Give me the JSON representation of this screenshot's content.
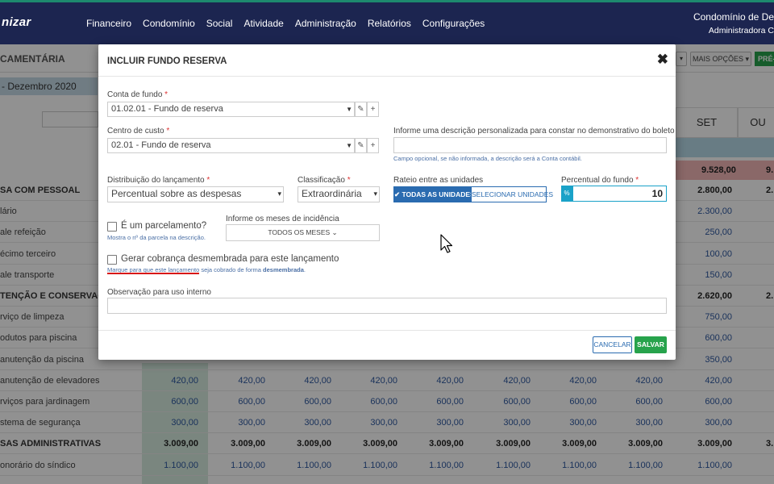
{
  "header": {
    "logo": "nizar",
    "nav": [
      "Financeiro",
      "Condomínio",
      "Social",
      "Atividade",
      "Administração",
      "Relatórios",
      "Configurações"
    ],
    "condo_name": "Condomínio de De",
    "condo_admin": "Administradora C"
  },
  "page": {
    "title": "CAMENTÁRIA",
    "period": "- Dezembro 2020",
    "mais_opcoes": "MAIS OPÇÕES",
    "pre_button": "PRÉ-",
    "columns": [
      "SET",
      "OU"
    ],
    "summary_set": "9.528,00",
    "summary_next": "9."
  },
  "background_rows": [
    {
      "label": "SA COM PESSOAL",
      "bold": true,
      "values": [],
      "set": "2.800,00",
      "next": "2."
    },
    {
      "label": "lário",
      "bold": false,
      "values": [],
      "set": "2.300,00",
      "next": ""
    },
    {
      "label": "ale refeição",
      "bold": false,
      "values": [],
      "set": "250,00",
      "next": ""
    },
    {
      "label": "écimo terceiro",
      "bold": false,
      "values": [],
      "set": "100,00",
      "next": ""
    },
    {
      "label": "ale transporte",
      "bold": false,
      "values": [],
      "set": "150,00",
      "next": ""
    },
    {
      "label": "TENÇÃO E CONSERVAÇÃO",
      "bold": true,
      "values": [],
      "set": "2.620,00",
      "next": "2."
    },
    {
      "label": "rviço de limpeza",
      "bold": false,
      "values": [],
      "set": "750,00",
      "next": ""
    },
    {
      "label": "odutos para piscina",
      "bold": false,
      "values": [],
      "set": "600,00",
      "next": ""
    },
    {
      "label": "anutenção da piscina",
      "bold": false,
      "values": [],
      "set": "350,00",
      "next": ""
    },
    {
      "label": "anutenção de elevadores",
      "bold": false,
      "values": [
        "420,00",
        "420,00",
        "420,00",
        "420,00",
        "420,00",
        "420,00",
        "420,00",
        "420,00"
      ],
      "set": "420,00",
      "next": ""
    },
    {
      "label": "rviços para jardinagem",
      "bold": false,
      "values": [
        "600,00",
        "600,00",
        "600,00",
        "600,00",
        "600,00",
        "600,00",
        "600,00",
        "600,00"
      ],
      "set": "600,00",
      "next": ""
    },
    {
      "label": "stema de segurança",
      "bold": false,
      "values": [
        "300,00",
        "300,00",
        "300,00",
        "300,00",
        "300,00",
        "300,00",
        "300,00",
        "300,00"
      ],
      "set": "300,00",
      "next": ""
    },
    {
      "label": "SAS ADMINISTRATIVAS",
      "bold": true,
      "values": [
        "3.009,00",
        "3.009,00",
        "3.009,00",
        "3.009,00",
        "3.009,00",
        "3.009,00",
        "3.009,00",
        "3.009,00"
      ],
      "set": "3.009,00",
      "next": "3."
    },
    {
      "label": "onorário do síndico",
      "bold": false,
      "values": [
        "1.100,00",
        "1.100,00",
        "1.100,00",
        "1.100,00",
        "1.100,00",
        "1.100,00",
        "1.100,00",
        "1.100,00"
      ],
      "set": "1.100,00",
      "next": ""
    }
  ],
  "modal": {
    "title": "INCLUIR FUNDO RESERVA",
    "close": "✖",
    "conta_label": "Conta de fundo",
    "conta_value": "01.02.01 - Fundo de reserva",
    "centro_label": "Centro de custo",
    "centro_value": "02.01 - Fundo de reserva",
    "descricao_label": "Informe uma descrição personalizada para constar no demonstrativo do boleto",
    "descricao_hint": "Campo opcional, se não informada, a descrição será a Conta contábil.",
    "distribuicao_label": "Distribuição do lançamento",
    "distribuicao_value": "Percentual sobre as despesas",
    "classificacao_label": "Classificação",
    "classificacao_value": "Extraordinária",
    "rateio_label": "Rateio entre as unidades",
    "rateio_todas": "✔ TODAS AS UNIDADES",
    "rateio_selecionar": "SELECIONAR UNIDADES",
    "percentual_label": "Percentual do fundo",
    "percentual_addon": "%",
    "percentual_value": "10",
    "parcelamento_label": "É um parcelamento?",
    "parcelamento_hint": "Mostra o nº da parcela na descrição.",
    "meses_label": "Informe os meses de incidência",
    "meses_value": "TODOS OS MESES ⌄",
    "desmembrada_label": "Gerar cobrança desmembrada para este lançamento",
    "desmembrada_hint_a": "Marque para que este lançamento seja cobrado de forma ",
    "desmembrada_hint_b": "desmembrada",
    "desmembrada_hint_c": ".",
    "observacao_label": "Observação para uso interno",
    "cancel": "CANCELAR",
    "save": "SALVAR"
  },
  "colors": {
    "navbar": "#1c2550",
    "accent_blue": "#2a6bb0",
    "save_green": "#27a34c",
    "underline_red": "#d81818"
  }
}
